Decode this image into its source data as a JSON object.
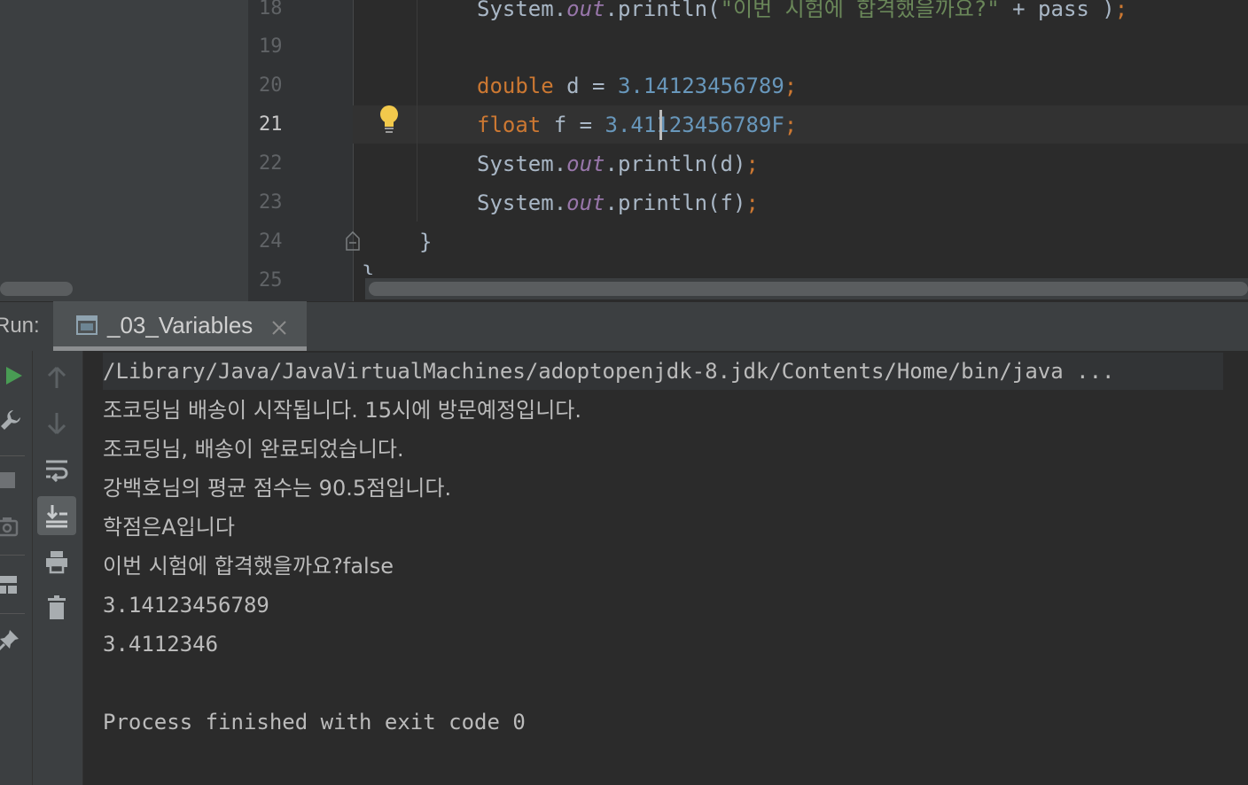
{
  "editor": {
    "line_numbers": [
      "18",
      "19",
      "20",
      "21",
      "22",
      "23",
      "24",
      "25"
    ],
    "current_line": "21",
    "lines": {
      "l18": {
        "obj": "System.",
        "field": "out",
        "method": ".println(",
        "str": "\"이번 시험에 합격했을까요?\"",
        "rest": " + pass )",
        "semi": ";"
      },
      "l20": {
        "type": "double",
        "decl": " d = ",
        "num": "3.14123456789",
        "semi": ";"
      },
      "l21": {
        "type": "float",
        "decl": " f = ",
        "num": "3.41123456789F",
        "semi": ";"
      },
      "l22": {
        "obj": "System.",
        "field": "out",
        "method": ".println(d)",
        "semi": ";"
      },
      "l23": {
        "obj": "System.",
        "field": "out",
        "method": ".println(f)",
        "semi": ";"
      },
      "l24": {
        "brace": "}"
      },
      "l25": {
        "brace": "}"
      }
    }
  },
  "run_window": {
    "label": "Run:",
    "tab_title": "_03_Variables",
    "tab_icon": "console-window-icon",
    "close_icon": "close-icon",
    "toolbar_left": [
      "rerun-icon",
      "wrench-icon",
      "stop-icon",
      "camera-icon",
      "layout-icon",
      "pin-icon"
    ],
    "toolbar": [
      "up-arrow-icon",
      "down-arrow-icon",
      "soft-wrap-icon",
      "scroll-to-end-icon",
      "print-icon",
      "trash-icon"
    ],
    "console_lines": [
      "/Library/Java/JavaVirtualMachines/adoptopenjdk-8.jdk/Contents/Home/bin/java ...",
      "조코딩님 배송이 시작됩니다. 15시에 방문예정입니다.",
      "조코딩님, 배송이 완료되었습니다.",
      "강백호님의 평균 점수는 90.5점입니다.",
      "학점은A입니다",
      "이번 시험에 합격했을까요?false",
      "3.14123456789",
      "3.4112346",
      "",
      "Process finished with exit code 0"
    ]
  },
  "colors": {
    "keyword": "#cc7832",
    "number": "#6897bb",
    "string": "#6a8759",
    "field": "#9876aa",
    "text": "#a9b7c6",
    "run_green": "#499c54",
    "bulb_yellow": "#f2c94c"
  }
}
